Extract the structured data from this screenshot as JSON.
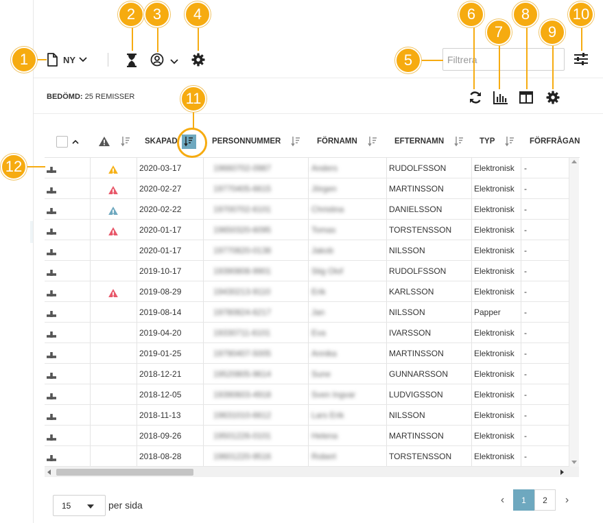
{
  "toolbar": {
    "new_label": "NY",
    "filter_placeholder": "Filtrera"
  },
  "subbar": {
    "status_label": "BEDÖMD:",
    "status_value": "25 REMISSER"
  },
  "table": {
    "columns": [
      "SKAPAD",
      "PERSONNUMMER",
      "FÖRNAMN",
      "EFTERNAMN",
      "TYP",
      "FÖRFRÅGAN"
    ],
    "rows": [
      {
        "warn": "yellow",
        "date": "2020-03-17",
        "pnr": "19660702-0987",
        "first": "Anders",
        "last": "RUDOLFSSON",
        "type": "Elektronisk",
        "req": "-"
      },
      {
        "warn": "red",
        "date": "2020-02-27",
        "pnr": "19770405-6615",
        "first": "Jörgen",
        "last": "MARTINSSON",
        "type": "Elektronisk",
        "req": "-"
      },
      {
        "warn": "blue",
        "date": "2020-02-22",
        "pnr": "19700702-6101",
        "first": "Christina",
        "last": "DANIELSSON",
        "type": "Elektronisk",
        "req": "-"
      },
      {
        "warn": "red",
        "date": "2020-01-17",
        "pnr": "19650320-6095",
        "first": "Tomas",
        "last": "TORSTENSSON",
        "type": "Elektronisk",
        "req": "-"
      },
      {
        "warn": "",
        "date": "2020-01-17",
        "pnr": "19770820-0138",
        "first": "Jakob",
        "last": "NILSSON",
        "type": "Elektronisk",
        "req": "-"
      },
      {
        "warn": "",
        "date": "2019-10-17",
        "pnr": "19390808-9901",
        "first": "Stig Olof",
        "last": "RUDOLFSSON",
        "type": "Elektronisk",
        "req": "-"
      },
      {
        "warn": "red",
        "date": "2019-08-29",
        "pnr": "19430213-9110",
        "first": "Erik",
        "last": "KARLSSON",
        "type": "Elektronisk",
        "req": "-"
      },
      {
        "warn": "",
        "date": "2019-08-14",
        "pnr": "19780824-6217",
        "first": "Jan",
        "last": "NILSSON",
        "type": "Papper",
        "req": "-"
      },
      {
        "warn": "",
        "date": "2019-04-20",
        "pnr": "19330711-6101",
        "first": "Eva",
        "last": "IVARSSON",
        "type": "Elektronisk",
        "req": "-"
      },
      {
        "warn": "",
        "date": "2019-01-25",
        "pnr": "19790407-5005",
        "first": "Annika",
        "last": "MARTINSSON",
        "type": "Elektronisk",
        "req": "-"
      },
      {
        "warn": "",
        "date": "2018-12-21",
        "pnr": "19520805-9614",
        "first": "Sune",
        "last": "GUNNARSSON",
        "type": "Elektronisk",
        "req": "-"
      },
      {
        "warn": "",
        "date": "2018-12-05",
        "pnr": "19390603-4918",
        "first": "Sven Ingvar",
        "last": "LUDVIGSSON",
        "type": "Elektronisk",
        "req": "-"
      },
      {
        "warn": "",
        "date": "2018-11-13",
        "pnr": "19631010-6612",
        "first": "Lars Erik",
        "last": "NILSSON",
        "type": "Elektronisk",
        "req": "-"
      },
      {
        "warn": "",
        "date": "2018-09-26",
        "pnr": "19501226-0101",
        "first": "Helena",
        "last": "MARTINSSON",
        "type": "Elektronisk",
        "req": "-"
      },
      {
        "warn": "",
        "date": "2018-08-28",
        "pnr": "19601220-9516",
        "first": "Robert",
        "last": "TORSTENSSON",
        "type": "Elektronisk",
        "req": "-"
      }
    ]
  },
  "footer": {
    "per_page_value": "15",
    "per_page_label": "per sida",
    "pages": [
      "1",
      "2"
    ],
    "prev": "‹",
    "next": "›"
  },
  "annotations": [
    "1",
    "2",
    "3",
    "4",
    "5",
    "6",
    "7",
    "8",
    "9",
    "10",
    "11",
    "12"
  ],
  "colors": {
    "accent": "#6ea8bf",
    "annotation": "#f6ab10",
    "warn_yellow": "#f6b21a",
    "warn_red": "#e8586a",
    "warn_blue": "#6ea8bf",
    "warn_gray": "#555555"
  }
}
